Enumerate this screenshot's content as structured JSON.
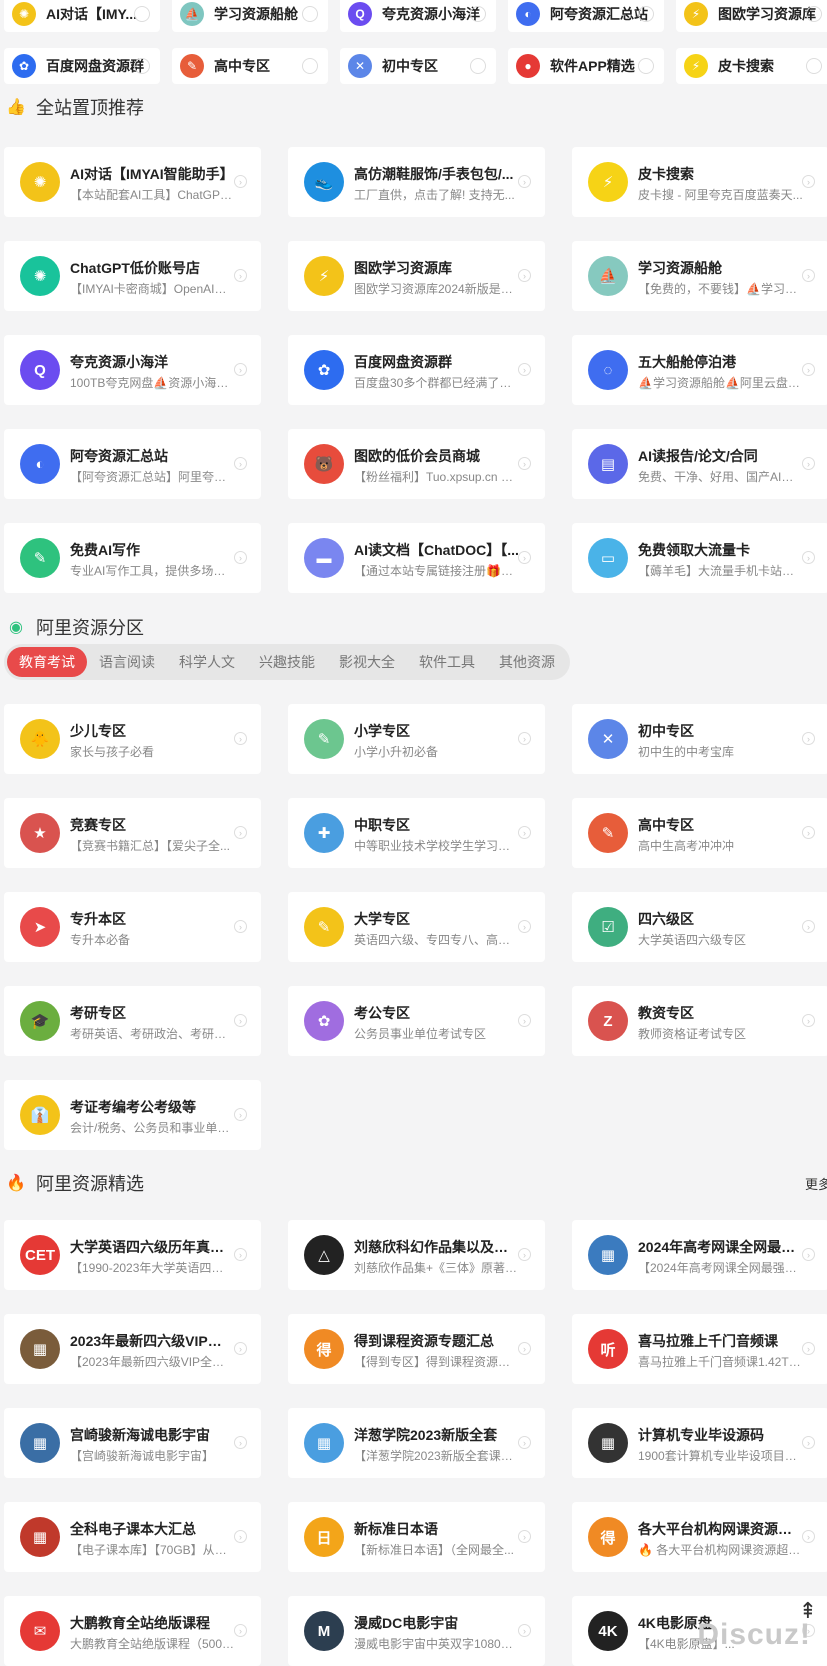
{
  "top_links": [
    {
      "label": "AI对话【IMY...",
      "color": "#f3c319",
      "glyph": "✺"
    },
    {
      "label": "学习资源船舱",
      "color": "#7fc6c0",
      "glyph": "⛵"
    },
    {
      "label": "夸克资源小海洋",
      "color": "#6b4cf0",
      "glyph": "Q"
    },
    {
      "label": "阿夸资源汇总站",
      "color": "#3f6df0",
      "glyph": "◐"
    },
    {
      "label": "图欧学习资源库",
      "color": "#f3c319",
      "glyph": "⚡"
    },
    {
      "label": "百度网盘资源群",
      "color": "#2d6cf0",
      "glyph": "✿"
    },
    {
      "label": "高中专区",
      "color": "#e75d3a",
      "glyph": "✎"
    },
    {
      "label": "初中专区",
      "color": "#5c86e8",
      "glyph": "✕"
    },
    {
      "label": "软件APP精选",
      "color": "#e53935",
      "glyph": "●"
    },
    {
      "label": "皮卡搜索",
      "color": "#f6d316",
      "glyph": "⚡"
    }
  ],
  "pinned": {
    "title": "全站置顶推荐",
    "icon": "thumbs-up-icon",
    "items": [
      {
        "name": "AI对话【IMYAI智能助手】",
        "desc": "【本站配套AI工具】ChatGPT4....",
        "color": "#f3c319",
        "glyph": "✺"
      },
      {
        "name": "高仿潮鞋服饰/手表包包/...",
        "desc": "工厂直供，点击了解! 支持无...",
        "color": "#1e8fe0",
        "glyph": "👟"
      },
      {
        "name": "皮卡搜索",
        "desc": "皮卡搜 - 阿里夸克百度蓝奏天...",
        "color": "#f6d316",
        "glyph": "⚡"
      },
      {
        "name": "ChatGPT低价账号店",
        "desc": "【IMYAI卡密商城】OpenAI官...",
        "color": "#19c39b",
        "glyph": "✺"
      },
      {
        "name": "图欧学习资源库",
        "desc": "图欧学习资源库2024新版是一...",
        "color": "#f3c319",
        "glyph": "⚡"
      },
      {
        "name": "学习资源船舱",
        "desc": "【免费的，不要钱】⛵学习资...",
        "color": "#86c9bf",
        "glyph": "⛵"
      },
      {
        "name": "夸克资源小海洋",
        "desc": "100TB夸克网盘⛵资源小海洋...",
        "color": "#6b4cf0",
        "glyph": "Q"
      },
      {
        "name": "百度网盘资源群",
        "desc": "百度盘30多个群都已经满了，...",
        "color": "#2d6cf0",
        "glyph": "✿"
      },
      {
        "name": "五大船舱停泊港",
        "desc": "⛵学习资源船舱⛵阿里云盘资...",
        "color": "#3f6df0",
        "glyph": "◌"
      },
      {
        "name": "阿夸资源汇总站",
        "desc": "【阿夸资源汇总站】阿里夸克...",
        "color": "#3f6df0",
        "glyph": "◐"
      },
      {
        "name": "图欧的低价会员商城",
        "desc": "【粉丝福利】Tuo.xpsup.cn 是...",
        "color": "#e74c3c",
        "glyph": "🐻"
      },
      {
        "name": "AI读报告/论文/合同",
        "desc": "免费、干净、好用、国产AI领先",
        "color": "#5b68e8",
        "glyph": "▤"
      },
      {
        "name": "免费AI写作",
        "desc": "专业AI写作工具，提供多场景A...",
        "color": "#2ec27e",
        "glyph": "✎"
      },
      {
        "name": "AI读文档【ChatDOC】【...",
        "desc": "【通过本站专属链接注册🎁即...",
        "color": "#7a86f0",
        "glyph": "▬"
      },
      {
        "name": "免费领取大流量卡",
        "desc": "【薅羊毛】大流量手机卡站长...",
        "color": "#4ab3e8",
        "glyph": "▭"
      }
    ]
  },
  "category": {
    "title": "阿里资源分区",
    "icon": "globe-icon",
    "tabs": [
      "教育考试",
      "语言阅读",
      "科学人文",
      "兴趣技能",
      "影视大全",
      "软件工具",
      "其他资源"
    ],
    "active_tab": "教育考试",
    "items": [
      {
        "name": "少儿专区",
        "desc": "家长与孩子必看",
        "color": "#f3c319",
        "glyph": "🐥"
      },
      {
        "name": "小学专区",
        "desc": "小学小升初必备",
        "color": "#6cc68f",
        "glyph": "✎"
      },
      {
        "name": "初中专区",
        "desc": "初中生的中考宝库",
        "color": "#5c86e8",
        "glyph": "✕"
      },
      {
        "name": "竞赛专区",
        "desc": "【竞赛书籍汇总】【爱尖子全...",
        "color": "#d9534f",
        "glyph": "★"
      },
      {
        "name": "中职专区",
        "desc": "中等职业技术学校学生学习专区",
        "color": "#4a9ee0",
        "glyph": "✚"
      },
      {
        "name": "高中专区",
        "desc": "高中生高考冲冲冲",
        "color": "#e75d3a",
        "glyph": "✎"
      },
      {
        "name": "专升本区",
        "desc": "专升本必备",
        "color": "#e84a4a",
        "glyph": "➤"
      },
      {
        "name": "大学专区",
        "desc": "英语四六级、专四专八、高等...",
        "color": "#f3c319",
        "glyph": "✎"
      },
      {
        "name": "四六级区",
        "desc": "大学英语四六级专区",
        "color": "#3fae80",
        "glyph": "☑"
      },
      {
        "name": "考研专区",
        "desc": "考研英语、考研政治、考研数...",
        "color": "#6bae3f",
        "glyph": "🎓"
      },
      {
        "name": "考公专区",
        "desc": "公务员事业单位考试专区",
        "color": "#a06de0",
        "glyph": "✿"
      },
      {
        "name": "教资专区",
        "desc": "教师资格证考试专区",
        "color": "#d9534f",
        "glyph": "Z"
      },
      {
        "name": "考证考编考公考级等",
        "desc": "会计/税务、公务员和事业单位...",
        "color": "#f3c319",
        "glyph": "👔"
      }
    ]
  },
  "featured": {
    "title": "阿里资源精选",
    "icon": "fire-icon",
    "more_label": "更多",
    "items": [
      {
        "name": "大学英语四六级历年真题...",
        "desc": "【1990-2023年大学英语四六级...",
        "color": "#e53935",
        "glyph": "CET"
      },
      {
        "name": "刘慈欣科幻作品集以及三...",
        "desc": "刘慈欣作品集+《三体》原著小...",
        "color": "#222222",
        "glyph": "△"
      },
      {
        "name": "2024年高考网课全网最强...",
        "desc": "【2024年高考网课全网最强合...",
        "color": "#3b7bbf",
        "glyph": "▦"
      },
      {
        "name": "2023年最新四六级VIP全程",
        "desc": "【2023年最新四六级VIP全程】...",
        "color": "#7a5c3b",
        "glyph": "▦"
      },
      {
        "name": "得到课程资源专题汇总",
        "desc": "【得到专区】得到课程资源专...",
        "color": "#f08a24",
        "glyph": "得"
      },
      {
        "name": "喜马拉雅上千门音频课",
        "desc": "喜马拉雅上千门音频课1.42T全...",
        "color": "#e53935",
        "glyph": "听"
      },
      {
        "name": "宫崎骏新海诚电影宇宙",
        "desc": "【宫崎骏新海诚电影宇宙】",
        "color": "#3a6ea5",
        "glyph": "▦"
      },
      {
        "name": "洋葱学院2023新版全套",
        "desc": "【洋葱学院2023新版全套课程...",
        "color": "#4a9ee0",
        "glyph": "▦"
      },
      {
        "name": "计算机专业毕设源码",
        "desc": "1900套计算机专业毕设项目代...",
        "color": "#333333",
        "glyph": "▦"
      },
      {
        "name": "全科电子课本大汇总",
        "desc": "【电子课本库】【70GB】从小...",
        "color": "#c0392b",
        "glyph": "▦"
      },
      {
        "name": "新标准日本语",
        "desc": "【新标准日本语】（全网最全...",
        "color": "#f3a519",
        "glyph": "日"
      },
      {
        "name": "各大平台机构网课资源超...",
        "desc": "🔥 各大平台机构网课资源超级...",
        "color": "#f08a24",
        "glyph": "得"
      },
      {
        "name": "大鹏教育全站绝版课程",
        "desc": "大鹏教育全站绝版课程（500余...",
        "color": "#e53935",
        "glyph": "✉"
      },
      {
        "name": "漫威DC电影宇宙",
        "desc": "漫威电影宇宙中英双字1080P4...",
        "color": "#2c3e50",
        "glyph": "M"
      },
      {
        "name": "4K电影原盘",
        "desc": "【4K电影原盘】...",
        "color": "#222222",
        "glyph": "4K"
      }
    ]
  },
  "watermark": "Discuz!",
  "back_to_top": "⇞"
}
